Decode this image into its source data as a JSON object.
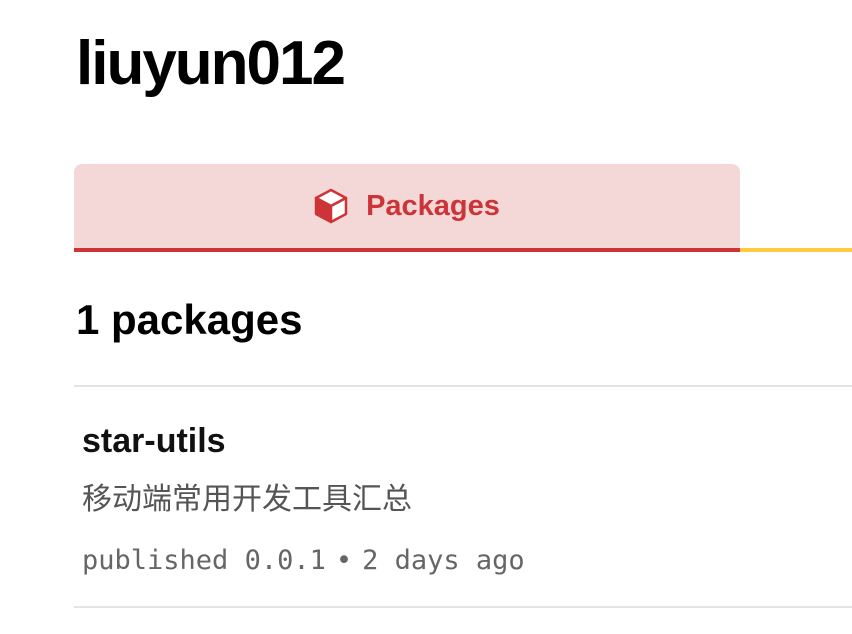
{
  "profile": {
    "username": "liuyun012"
  },
  "tabs": [
    {
      "label": "Packages",
      "icon": "package-cube-icon",
      "active": true
    }
  ],
  "packages": {
    "count_label": "1 packages",
    "items": [
      {
        "name": "star-utils",
        "description": "移动端常用开发工具汇总",
        "published_label": "published",
        "version": "0.0.1",
        "separator": "•",
        "time_ago": "2 days ago"
      }
    ]
  },
  "colors": {
    "accent_red": "#cc3438",
    "tab_active_bg": "#f4d8d8",
    "tab_underline_yellow": "#ffc940",
    "divider": "#e4e4e4"
  }
}
